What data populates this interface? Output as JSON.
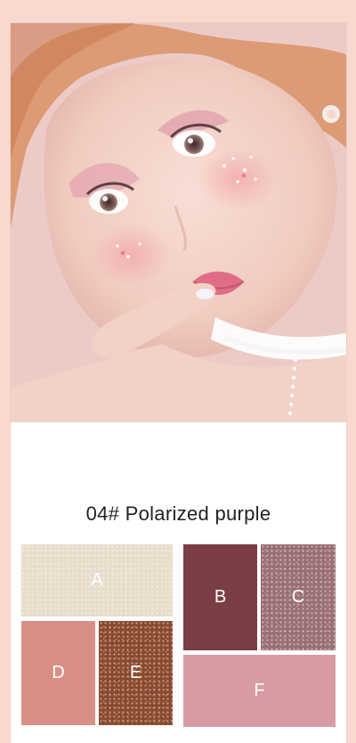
{
  "caption": "04# Polarized purple",
  "swatches": [
    {
      "id": "a",
      "label": "A",
      "color": "#e8dccb"
    },
    {
      "id": "b",
      "label": "B",
      "color": "#7c3e45"
    },
    {
      "id": "c",
      "label": "C",
      "color": "#9a6f74"
    },
    {
      "id": "d",
      "label": "D",
      "color": "#d98f86"
    },
    {
      "id": "e",
      "label": "E",
      "color": "#8a4a2e"
    },
    {
      "id": "f",
      "label": "F",
      "color": "#d79ba4"
    }
  ]
}
